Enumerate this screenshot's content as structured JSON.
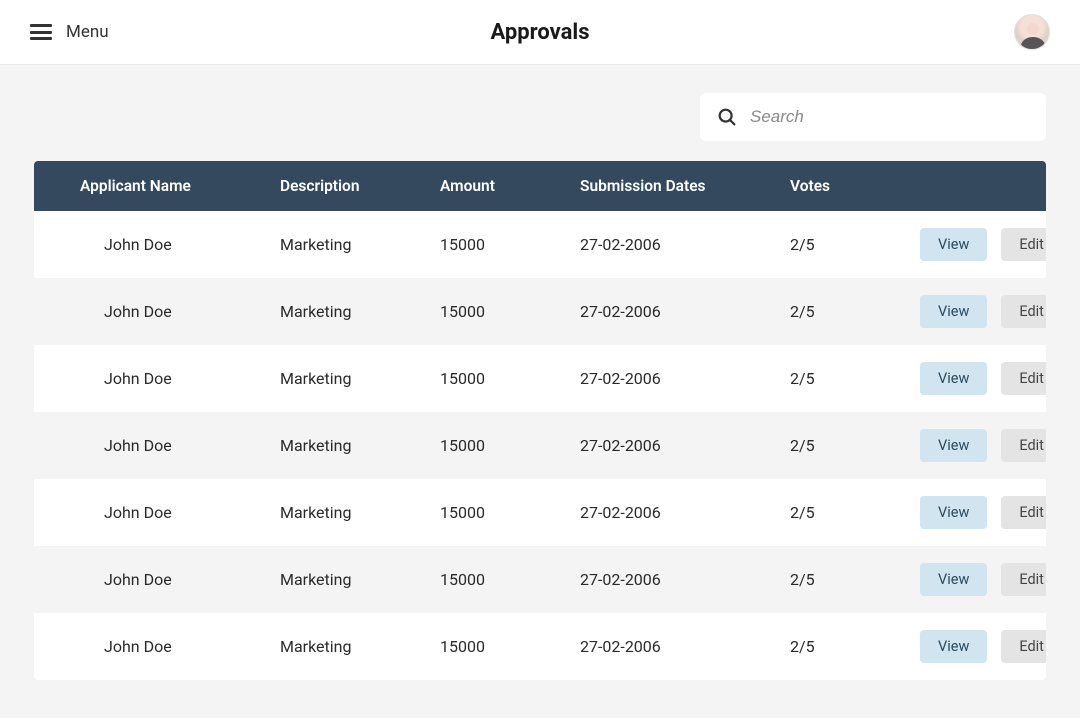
{
  "header": {
    "menu_label": "Menu",
    "title": "Approvals"
  },
  "search": {
    "placeholder": "Search",
    "value": ""
  },
  "table": {
    "columns": {
      "applicant": "Applicant Name",
      "description": "Description",
      "amount": "Amount",
      "submission": "Submission Dates",
      "votes": "Votes"
    },
    "actions": {
      "view": "View",
      "edit": "Edit"
    },
    "rows": [
      {
        "applicant": "John Doe",
        "description": "Marketing",
        "amount": "15000",
        "submission": "27-02-2006",
        "votes": "2/5"
      },
      {
        "applicant": "John Doe",
        "description": "Marketing",
        "amount": "15000",
        "submission": "27-02-2006",
        "votes": "2/5"
      },
      {
        "applicant": "John Doe",
        "description": "Marketing",
        "amount": "15000",
        "submission": "27-02-2006",
        "votes": "2/5"
      },
      {
        "applicant": "John Doe",
        "description": "Marketing",
        "amount": "15000",
        "submission": "27-02-2006",
        "votes": "2/5"
      },
      {
        "applicant": "John Doe",
        "description": "Marketing",
        "amount": "15000",
        "submission": "27-02-2006",
        "votes": "2/5"
      },
      {
        "applicant": "John Doe",
        "description": "Marketing",
        "amount": "15000",
        "submission": "27-02-2006",
        "votes": "2/5"
      },
      {
        "applicant": "John Doe",
        "description": "Marketing",
        "amount": "15000",
        "submission": "27-02-2006",
        "votes": "2/5"
      }
    ]
  }
}
